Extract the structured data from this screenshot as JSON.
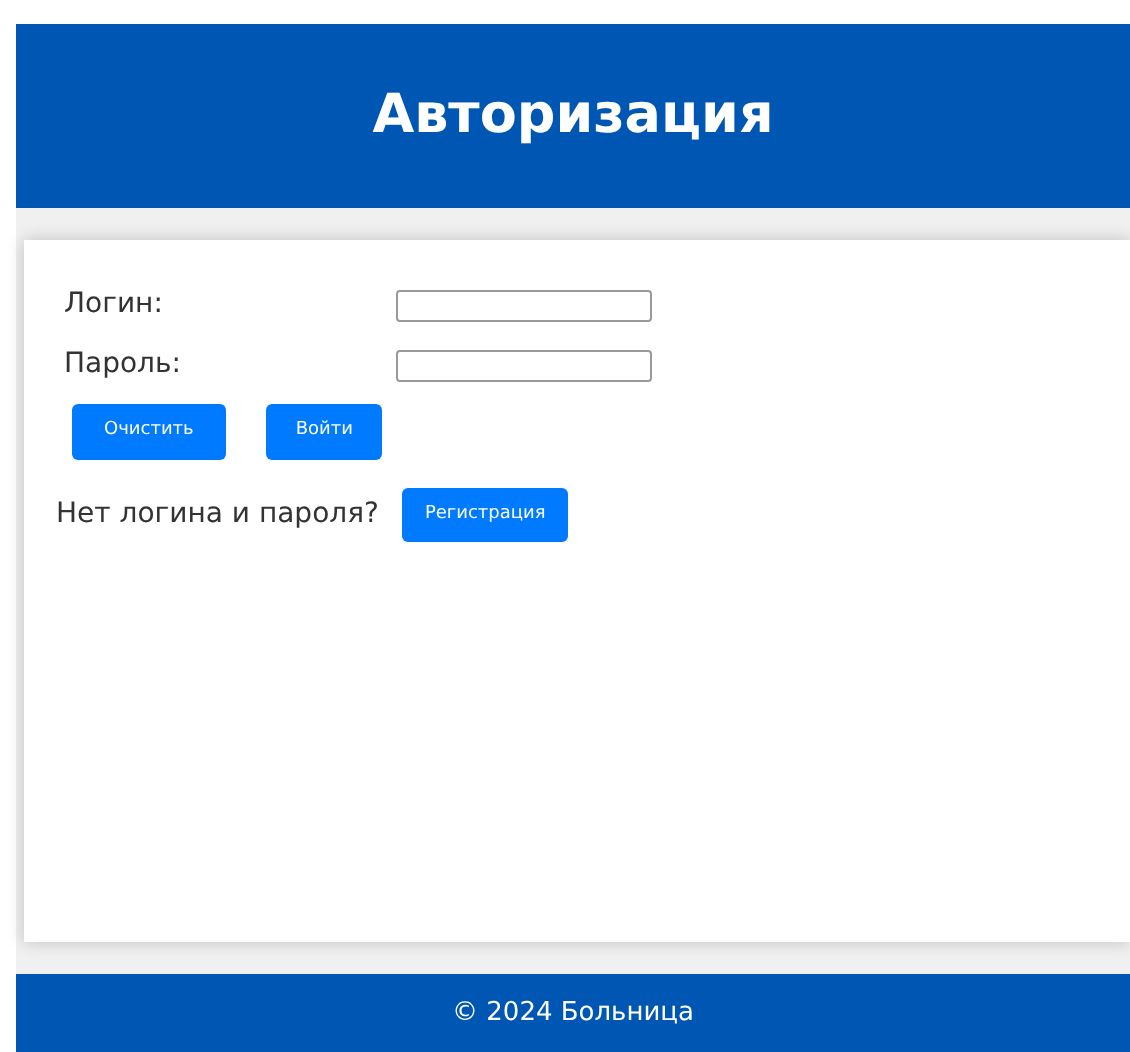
{
  "header": {
    "title": "Авторизация"
  },
  "form": {
    "fields": [
      {
        "label": "Логин:"
      },
      {
        "label": "Пароль:"
      }
    ],
    "buttons": [
      "Очистить",
      "Войти"
    ],
    "register_prompt": "Нет логина и пароля?",
    "register_button": "Регистрация"
  },
  "footer": {
    "text": "© 2024 Больница"
  }
}
